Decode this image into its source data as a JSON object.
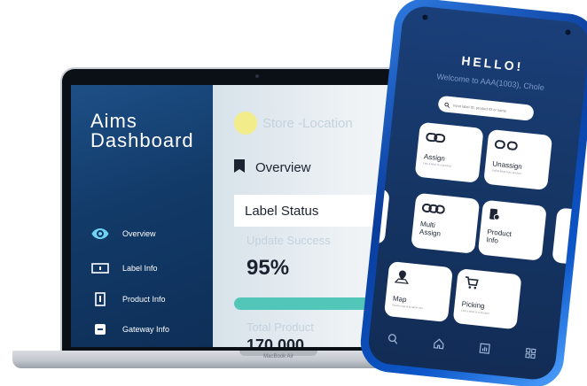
{
  "laptop": {
    "brand": {
      "line1": "Aims",
      "line2": "Dashboard"
    },
    "sidebar": {
      "items": [
        {
          "label": "Overview",
          "icon": "eye-icon",
          "active": true
        },
        {
          "label": "Label Info",
          "icon": "label-icon"
        },
        {
          "label": "Product Info",
          "icon": "product-icon"
        },
        {
          "label": "Gateway Info",
          "icon": "gateway-icon"
        },
        {
          "label": "",
          "icon": "grid-icon"
        }
      ]
    },
    "main": {
      "store_label": "Store -Location",
      "section_title": "Overview",
      "card_title": "Label Status",
      "update_label": "Update Success",
      "update_value": "95%",
      "update_fraction": 0.95,
      "total_label": "Total Product",
      "total_value": "170,000"
    },
    "model": "MacBook Air"
  },
  "phone": {
    "hello": "HELLO!",
    "welcome": "Welcome to AAA(1003), Chole",
    "search_placeholder": "Input label ID, product ID or name",
    "tiles": {
      "assign": {
        "label": "Assign",
        "sub": "Link a label to a product"
      },
      "unassign": {
        "label": "Unassign",
        "sub": "Unlink label from product"
      },
      "multi_line1": "Multi",
      "multi_line2": "Assign",
      "product_line1": "Product",
      "product_line2": "Info",
      "map": {
        "label": "Map",
        "sub": "Check map & location info"
      },
      "picking": {
        "label": "Picking",
        "sub": "Link a label to a product"
      }
    }
  },
  "colors": {
    "sidebar": "#123a68",
    "accent_progress": "#52c6b9",
    "store_dot": "#f2ec8a",
    "phone_frame": "#0c56c8"
  }
}
